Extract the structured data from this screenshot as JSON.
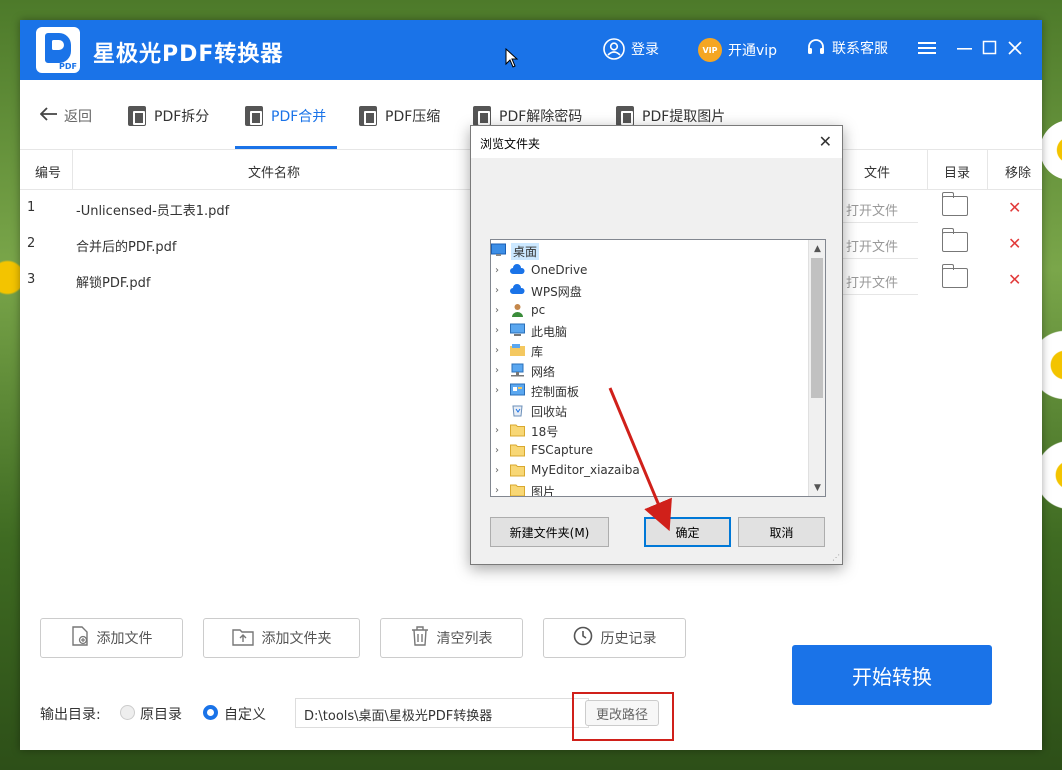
{
  "window": {
    "title": "星极光PDF转换器",
    "login": "登录",
    "vip": "开通vip",
    "vip_badge": "VIP",
    "service": "联系客服",
    "logo_text": "PDF"
  },
  "nav": {
    "back": "返回",
    "tabs": [
      "PDF拆分",
      "PDF合并",
      "PDF压缩",
      "PDF解除密码",
      "PDF提取图片"
    ],
    "active_tab": "PDF合并"
  },
  "table": {
    "headers": [
      "编号",
      "文件名称",
      "文件",
      "目录",
      "移除"
    ],
    "rows": [
      {
        "no": "1",
        "name": "-Unlicensed-员工表1.pdf",
        "open": "打开文件"
      },
      {
        "no": "2",
        "name": "合并后的PDF.pdf",
        "open": "打开文件"
      },
      {
        "no": "3",
        "name": "解锁PDF.pdf",
        "open": "打开文件"
      }
    ]
  },
  "actions": {
    "add_file": "添加文件",
    "add_folder": "添加文件夹",
    "clear_list": "清空列表",
    "history": "历史记录",
    "start": "开始转换"
  },
  "output": {
    "label": "输出目录:",
    "option_original": "原目录",
    "option_custom": "自定义",
    "selected": "自定义",
    "path": "D:\\tools\\桌面\\星极光PDF转换器",
    "change_path": "更改路径"
  },
  "dialog": {
    "title": "浏览文件夹",
    "tree": [
      {
        "label": "桌面",
        "icon": "desktop-icon",
        "expandable": false,
        "selected": true,
        "indent": 0
      },
      {
        "label": "OneDrive",
        "icon": "cloud-icon",
        "expandable": true,
        "indent": 1
      },
      {
        "label": "WPS网盘",
        "icon": "cloud-icon",
        "expandable": true,
        "indent": 1
      },
      {
        "label": "pc",
        "icon": "user-icon",
        "expandable": true,
        "indent": 1
      },
      {
        "label": "此电脑",
        "icon": "computer-icon",
        "expandable": true,
        "indent": 1
      },
      {
        "label": "库",
        "icon": "library-icon",
        "expandable": true,
        "indent": 1
      },
      {
        "label": "网络",
        "icon": "network-icon",
        "expandable": true,
        "indent": 1
      },
      {
        "label": "控制面板",
        "icon": "control-panel-icon",
        "expandable": true,
        "indent": 1
      },
      {
        "label": "回收站",
        "icon": "recycle-bin-icon",
        "expandable": false,
        "indent": 1
      },
      {
        "label": "18号",
        "icon": "folder-icon",
        "expandable": true,
        "indent": 1
      },
      {
        "label": "FSCapture",
        "icon": "folder-icon",
        "expandable": true,
        "indent": 1
      },
      {
        "label": "MyEditor_xiazaiba",
        "icon": "folder-icon",
        "expandable": true,
        "indent": 1
      },
      {
        "label": "图片",
        "icon": "folder-icon",
        "expandable": true,
        "indent": 1
      }
    ],
    "new_folder": "新建文件夹(M)",
    "ok": "确定",
    "cancel": "取消"
  },
  "colors": {
    "accent": "#1a73e8",
    "remove": "#e23b3b",
    "highlight": "#d0201a",
    "arrow": "#d0201a"
  }
}
